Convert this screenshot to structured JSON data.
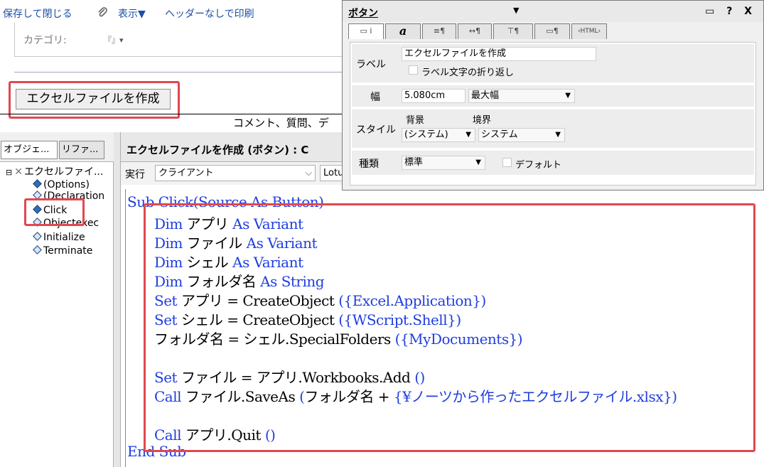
{
  "toolbar": {
    "save_close": "保存して閉じる",
    "attach_icon": "paperclip-icon",
    "view": "表示▼",
    "print": "ヘッダーなしで印刷"
  },
  "form": {
    "category_label": "カテゴリ:",
    "category_value": "『』▾",
    "button_label": "エクセルファイルを作成",
    "comment_text": "コメント、質問、デ"
  },
  "object_panel": {
    "tabs": [
      "オブジェ...",
      "リファ..."
    ],
    "tree": {
      "root": "エクセルファイ...",
      "items": [
        "(Options)",
        "(Declaration",
        "Click",
        "Objectexec",
        "Initialize",
        "Terminate"
      ]
    }
  },
  "editor": {
    "title": "エクセルファイルを作成 (ボタン) : C",
    "run_label": "実行",
    "run_value": "クライアント",
    "lang_value": "Lotu",
    "code": [
      {
        "indent": false,
        "parts": [
          {
            "t": "Sub Click(Source As Button)",
            "kw": true
          }
        ]
      },
      {
        "indent": true,
        "parts": [
          {
            "t": "Dim ",
            "kw": true
          },
          {
            "t": "アプリ ",
            "kw": false
          },
          {
            "t": "As Variant",
            "kw": true
          }
        ]
      },
      {
        "indent": true,
        "parts": [
          {
            "t": "Dim ",
            "kw": true
          },
          {
            "t": "ファイル ",
            "kw": false
          },
          {
            "t": "As Variant",
            "kw": true
          }
        ]
      },
      {
        "indent": true,
        "parts": [
          {
            "t": "Dim ",
            "kw": true
          },
          {
            "t": "シェル ",
            "kw": false
          },
          {
            "t": "As Variant",
            "kw": true
          }
        ]
      },
      {
        "indent": true,
        "parts": [
          {
            "t": "Dim ",
            "kw": true
          },
          {
            "t": "フォルダ名 ",
            "kw": false
          },
          {
            "t": "As String",
            "kw": true
          }
        ]
      },
      {
        "indent": true,
        "parts": [
          {
            "t": "Set ",
            "kw": true
          },
          {
            "t": "アプリ = CreateObject ",
            "kw": false
          },
          {
            "t": "({Excel.Application})",
            "kw": true
          }
        ]
      },
      {
        "indent": true,
        "parts": [
          {
            "t": "Set ",
            "kw": true
          },
          {
            "t": "シェル = CreateObject ",
            "kw": false
          },
          {
            "t": "({WScript.Shell})",
            "kw": true
          }
        ]
      },
      {
        "indent": true,
        "parts": [
          {
            "t": "フォルダ名 = シェル.SpecialFolders ",
            "kw": false
          },
          {
            "t": "({MyDocuments})",
            "kw": true
          }
        ]
      },
      {
        "indent": true,
        "parts": [
          {
            "t": "",
            "kw": false
          }
        ]
      },
      {
        "indent": true,
        "parts": [
          {
            "t": "Set ",
            "kw": true
          },
          {
            "t": "ファイル = アプリ.Workbooks.Add ",
            "kw": false
          },
          {
            "t": "()",
            "kw": true
          }
        ]
      },
      {
        "indent": true,
        "parts": [
          {
            "t": "Call ",
            "kw": true
          },
          {
            "t": "ファイル.SaveAs ",
            "kw": false
          },
          {
            "t": "(",
            "kw": true
          },
          {
            "t": "フォルダ名 + ",
            "kw": false
          },
          {
            "t": "{¥ノーツから作ったエクセルファイル.xlsx})",
            "kw": true
          }
        ]
      },
      {
        "indent": true,
        "parts": [
          {
            "t": "",
            "kw": false
          }
        ]
      },
      {
        "indent": true,
        "parts": [
          {
            "t": "Call ",
            "kw": true
          },
          {
            "t": "アプリ.Quit ",
            "kw": false
          },
          {
            "t": "()",
            "kw": true
          }
        ]
      },
      {
        "indent": false,
        "parts": [
          {
            "t": "End Sub",
            "kw": true
          }
        ]
      }
    ]
  },
  "properties": {
    "title": "ボタン",
    "title_arrow": "▼",
    "controls": "▭ ? X",
    "tabs": [
      "▭ i",
      "a",
      "≡¶",
      "↔¶",
      "⊤¶",
      "▭¶",
      "‹HTML›"
    ],
    "label_row": {
      "label": "ラベル",
      "value": "エクセルファイルを作成",
      "wrap": "ラベル文字の折り返し"
    },
    "width_row": {
      "label": "幅",
      "value": "5.080cm",
      "mode": "最大幅"
    },
    "style_row": {
      "label": "スタイル",
      "bg_label": "背景",
      "border_label": "境界",
      "bg_value": "(システム)",
      "border_value": "システム"
    },
    "type_row": {
      "label": "種類",
      "value": "標準",
      "default": "デフォルト"
    }
  }
}
